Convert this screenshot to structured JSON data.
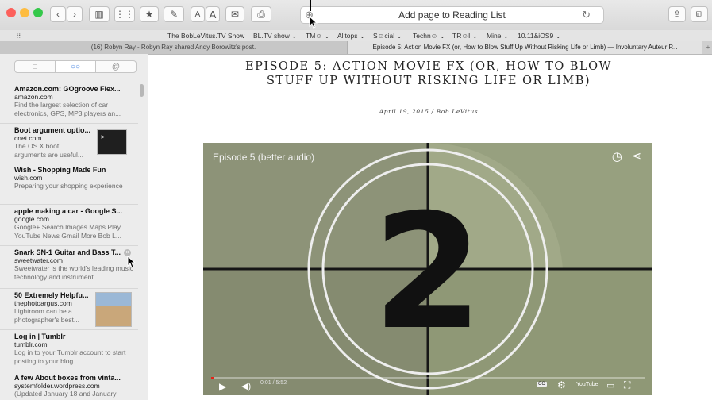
{
  "toolbar": {
    "traffic_lights": [
      "#fc605b",
      "#fdbc40",
      "#34c84a"
    ],
    "buttons": [
      {
        "name": "back-button",
        "glyph": "‹"
      },
      {
        "name": "forward-button",
        "glyph": "›"
      },
      {
        "name": "sidebar-toggle-button",
        "glyph": "▥"
      },
      {
        "name": "top-sites-button",
        "glyph": "⋮⋮"
      },
      {
        "name": "bookmark-button",
        "glyph": "★"
      },
      {
        "name": "annotate-button",
        "glyph": "✎"
      },
      {
        "name": "font-smaller-button",
        "glyph": "A"
      },
      {
        "name": "font-larger-button",
        "glyph": "A"
      },
      {
        "name": "email-button",
        "glyph": "✉"
      },
      {
        "name": "print-button",
        "glyph": "⎙"
      }
    ],
    "address_text": "Add page to Reading List",
    "add_glyph": "⊕",
    "reload_glyph": "↻",
    "share_glyph": "⇪",
    "tabs_glyph": "⧉"
  },
  "favorites": {
    "grid_glyph": "⠿",
    "items": [
      "The BobLeVitus.TV Show",
      "BL.TV show ⌄",
      "TM☺ ⌄",
      "Alltops ⌄",
      "S☺cial ⌄",
      "Techn☺ ⌄",
      "TR☺I ⌄",
      "Mine ⌄",
      "10.11&iOS9 ⌄"
    ]
  },
  "tabs": [
    {
      "label": "(16) Robyn Ray - Robyn Ray shared Andy Borowitz's post."
    },
    {
      "label": "Episode 5: Action Movie FX (or, How to Blow Stuff Up Without Risking Life or Limb) — Involuntary Auteur P..."
    }
  ],
  "sidebar": {
    "segments": [
      "□",
      "○○",
      "@"
    ],
    "items": [
      {
        "title": "Amazon.com: GOgroove Flex...",
        "domain": "amazon.com",
        "desc": "Find the largest selection of car electronics, GPS, MP3 players an..."
      },
      {
        "title": "Boot argument optio...",
        "domain": "cnet.com",
        "desc": "The OS X boot arguments are useful...",
        "thumb": ">_"
      },
      {
        "title": "Wish - Shopping Made Fun",
        "domain": "wish.com",
        "desc": "Preparing your shopping experience"
      },
      {
        "title": "apple making a car - Google S...",
        "domain": "google.com",
        "desc": "Google+ Search Images Maps Play YouTube News Gmail More Bob L..."
      },
      {
        "title": "Snark SN-1 Guitar and Bass T...",
        "domain": "sweetwater.com",
        "desc": "Sweetwater is the world's leading music technology and instrument..."
      },
      {
        "title": "50 Extremely Helpfu...",
        "domain": "thephotoargus.com",
        "desc": "Lightroom can be a photographer's best..."
      },
      {
        "title": "Log in | Tumblr",
        "domain": "tumblr.com",
        "desc": "Log in to your Tumblr account to start posting to your blog."
      },
      {
        "title": "A few About boxes from vinta...",
        "domain": "systemfolder.wordpress.com",
        "desc": "(Updated January 18 and January"
      }
    ]
  },
  "article": {
    "title": "EPISODE 5: ACTION MOVIE FX (OR, HOW TO BLOW STUFF UP WITHOUT RISKING LIFE OR LIMB)",
    "byline": "April 19, 2015 / Bob LeVitus"
  },
  "video": {
    "title": "Episode 5 (better audio)",
    "countdown_number": "2",
    "time": "0:01 / 5:52",
    "progress_fraction": 0.005,
    "youtube_label": "YouTube",
    "cc_label": "CC"
  }
}
